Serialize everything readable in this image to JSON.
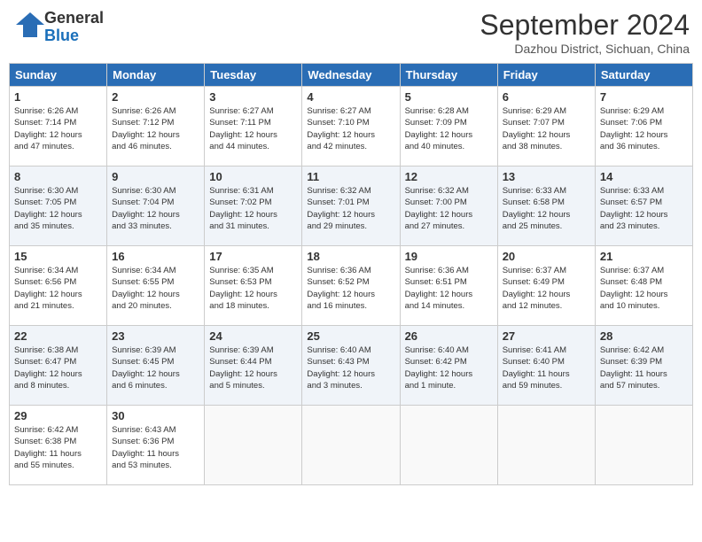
{
  "header": {
    "logo_general": "General",
    "logo_blue": "Blue",
    "month": "September 2024",
    "location": "Dazhou District, Sichuan, China"
  },
  "weekdays": [
    "Sunday",
    "Monday",
    "Tuesday",
    "Wednesday",
    "Thursday",
    "Friday",
    "Saturday"
  ],
  "weeks": [
    [
      {
        "day": "1",
        "info": "Sunrise: 6:26 AM\nSunset: 7:14 PM\nDaylight: 12 hours\nand 47 minutes."
      },
      {
        "day": "2",
        "info": "Sunrise: 6:26 AM\nSunset: 7:12 PM\nDaylight: 12 hours\nand 46 minutes."
      },
      {
        "day": "3",
        "info": "Sunrise: 6:27 AM\nSunset: 7:11 PM\nDaylight: 12 hours\nand 44 minutes."
      },
      {
        "day": "4",
        "info": "Sunrise: 6:27 AM\nSunset: 7:10 PM\nDaylight: 12 hours\nand 42 minutes."
      },
      {
        "day": "5",
        "info": "Sunrise: 6:28 AM\nSunset: 7:09 PM\nDaylight: 12 hours\nand 40 minutes."
      },
      {
        "day": "6",
        "info": "Sunrise: 6:29 AM\nSunset: 7:07 PM\nDaylight: 12 hours\nand 38 minutes."
      },
      {
        "day": "7",
        "info": "Sunrise: 6:29 AM\nSunset: 7:06 PM\nDaylight: 12 hours\nand 36 minutes."
      }
    ],
    [
      {
        "day": "8",
        "info": "Sunrise: 6:30 AM\nSunset: 7:05 PM\nDaylight: 12 hours\nand 35 minutes."
      },
      {
        "day": "9",
        "info": "Sunrise: 6:30 AM\nSunset: 7:04 PM\nDaylight: 12 hours\nand 33 minutes."
      },
      {
        "day": "10",
        "info": "Sunrise: 6:31 AM\nSunset: 7:02 PM\nDaylight: 12 hours\nand 31 minutes."
      },
      {
        "day": "11",
        "info": "Sunrise: 6:32 AM\nSunset: 7:01 PM\nDaylight: 12 hours\nand 29 minutes."
      },
      {
        "day": "12",
        "info": "Sunrise: 6:32 AM\nSunset: 7:00 PM\nDaylight: 12 hours\nand 27 minutes."
      },
      {
        "day": "13",
        "info": "Sunrise: 6:33 AM\nSunset: 6:58 PM\nDaylight: 12 hours\nand 25 minutes."
      },
      {
        "day": "14",
        "info": "Sunrise: 6:33 AM\nSunset: 6:57 PM\nDaylight: 12 hours\nand 23 minutes."
      }
    ],
    [
      {
        "day": "15",
        "info": "Sunrise: 6:34 AM\nSunset: 6:56 PM\nDaylight: 12 hours\nand 21 minutes."
      },
      {
        "day": "16",
        "info": "Sunrise: 6:34 AM\nSunset: 6:55 PM\nDaylight: 12 hours\nand 20 minutes."
      },
      {
        "day": "17",
        "info": "Sunrise: 6:35 AM\nSunset: 6:53 PM\nDaylight: 12 hours\nand 18 minutes."
      },
      {
        "day": "18",
        "info": "Sunrise: 6:36 AM\nSunset: 6:52 PM\nDaylight: 12 hours\nand 16 minutes."
      },
      {
        "day": "19",
        "info": "Sunrise: 6:36 AM\nSunset: 6:51 PM\nDaylight: 12 hours\nand 14 minutes."
      },
      {
        "day": "20",
        "info": "Sunrise: 6:37 AM\nSunset: 6:49 PM\nDaylight: 12 hours\nand 12 minutes."
      },
      {
        "day": "21",
        "info": "Sunrise: 6:37 AM\nSunset: 6:48 PM\nDaylight: 12 hours\nand 10 minutes."
      }
    ],
    [
      {
        "day": "22",
        "info": "Sunrise: 6:38 AM\nSunset: 6:47 PM\nDaylight: 12 hours\nand 8 minutes."
      },
      {
        "day": "23",
        "info": "Sunrise: 6:39 AM\nSunset: 6:45 PM\nDaylight: 12 hours\nand 6 minutes."
      },
      {
        "day": "24",
        "info": "Sunrise: 6:39 AM\nSunset: 6:44 PM\nDaylight: 12 hours\nand 5 minutes."
      },
      {
        "day": "25",
        "info": "Sunrise: 6:40 AM\nSunset: 6:43 PM\nDaylight: 12 hours\nand 3 minutes."
      },
      {
        "day": "26",
        "info": "Sunrise: 6:40 AM\nSunset: 6:42 PM\nDaylight: 12 hours\nand 1 minute."
      },
      {
        "day": "27",
        "info": "Sunrise: 6:41 AM\nSunset: 6:40 PM\nDaylight: 11 hours\nand 59 minutes."
      },
      {
        "day": "28",
        "info": "Sunrise: 6:42 AM\nSunset: 6:39 PM\nDaylight: 11 hours\nand 57 minutes."
      }
    ],
    [
      {
        "day": "29",
        "info": "Sunrise: 6:42 AM\nSunset: 6:38 PM\nDaylight: 11 hours\nand 55 minutes."
      },
      {
        "day": "30",
        "info": "Sunrise: 6:43 AM\nSunset: 6:36 PM\nDaylight: 11 hours\nand 53 minutes."
      },
      {
        "day": "",
        "info": ""
      },
      {
        "day": "",
        "info": ""
      },
      {
        "day": "",
        "info": ""
      },
      {
        "day": "",
        "info": ""
      },
      {
        "day": "",
        "info": ""
      }
    ]
  ]
}
